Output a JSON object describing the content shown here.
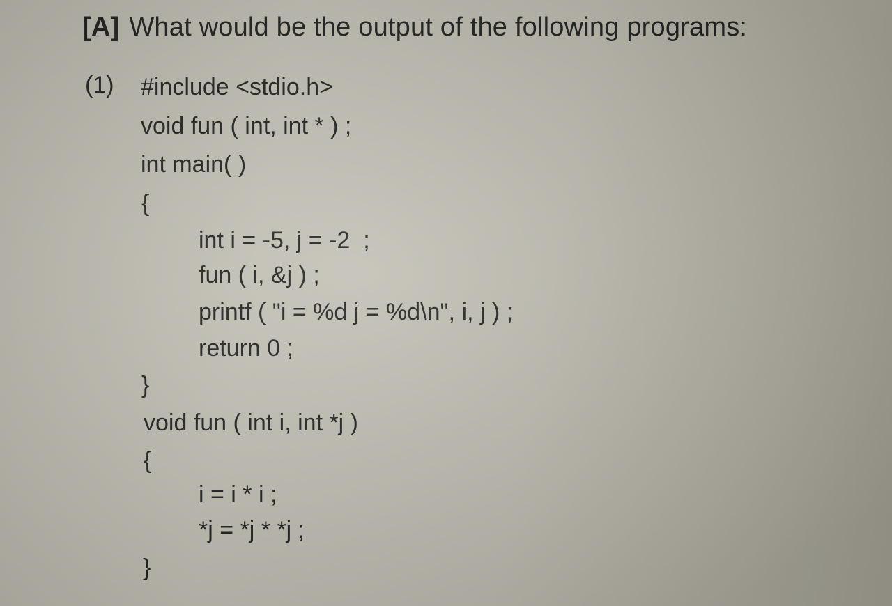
{
  "question": {
    "label": "[A]",
    "text": "What would be the output of the following programs:"
  },
  "program": {
    "number": "(1)",
    "lines": [
      "#include <stdio.h>",
      "void fun ( int, int * ) ;",
      "int main( )",
      "{",
      "int i = -5, j = -2  ;",
      "fun ( i, &j ) ;",
      "printf ( \"i = %d j = %d\\n\", i, j ) ;",
      "return 0 ;",
      "}",
      "void fun ( int i, int *j )",
      "{",
      "i = i * i ;",
      "*j = *j * *j ;",
      "}"
    ]
  }
}
